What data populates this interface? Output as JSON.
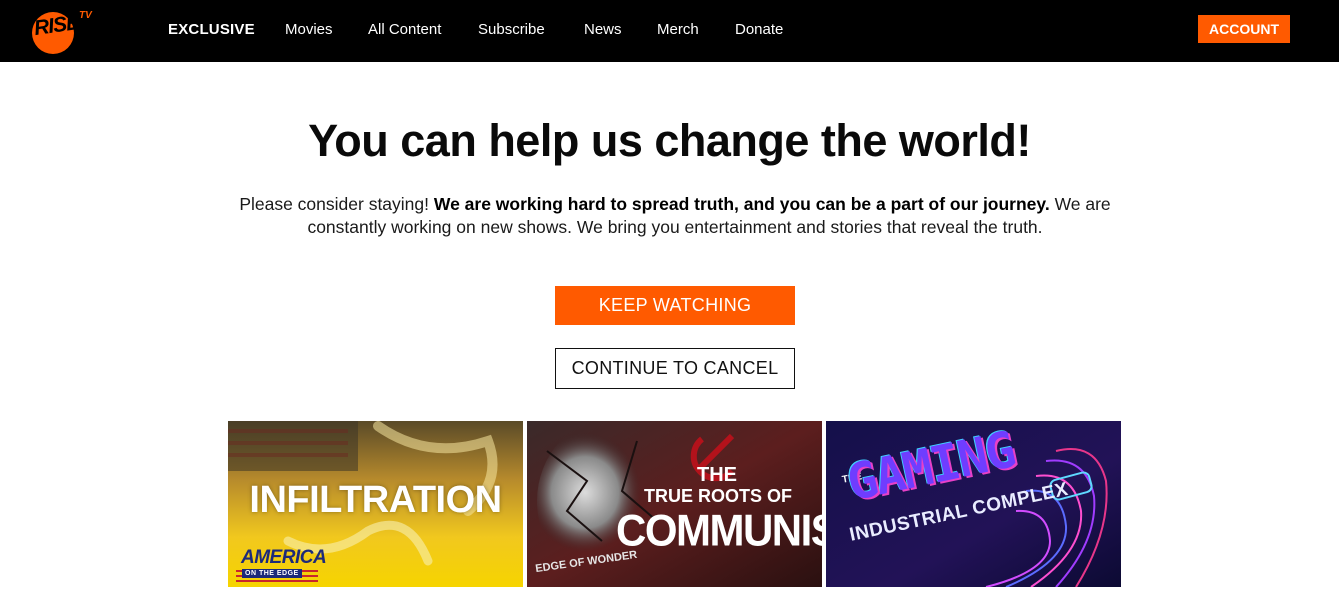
{
  "brand": {
    "logo_text": "RISE",
    "logo_suffix": "TV",
    "accent_color": "#ff5a00"
  },
  "nav": {
    "items": [
      {
        "label": "EXCLUSIVE"
      },
      {
        "label": "Movies"
      },
      {
        "label": "All Content"
      },
      {
        "label": "Subscribe"
      },
      {
        "label": "News"
      },
      {
        "label": "Merch"
      },
      {
        "label": "Donate"
      }
    ],
    "account_label": "ACCOUNT"
  },
  "main": {
    "title": "You can help us change the world!",
    "intro": {
      "part1": "Please consider staying! ",
      "bold": "We are working hard to spread truth, and you can be a part of our journey.",
      "part2": " We are constantly working on new shows. We bring you entertainment and stories that reveal the truth."
    },
    "keep_watching_label": "KEEP WATCHING",
    "continue_cancel_label": "CONTINUE TO CANCEL"
  },
  "thumbnails": [
    {
      "title": "INFILTRATION",
      "brand": "AMERICA",
      "brand_sub": "ON THE EDGE"
    },
    {
      "title_line1": "THE",
      "title_line2": "TRUE ROOTS OF",
      "title_line3": "COMMUNISM",
      "brand": "EDGE OF WONDER"
    },
    {
      "title_the": "THE",
      "title_main": "GAMING",
      "title_sub": "INDUSTRIAL COMPLEX"
    }
  ]
}
